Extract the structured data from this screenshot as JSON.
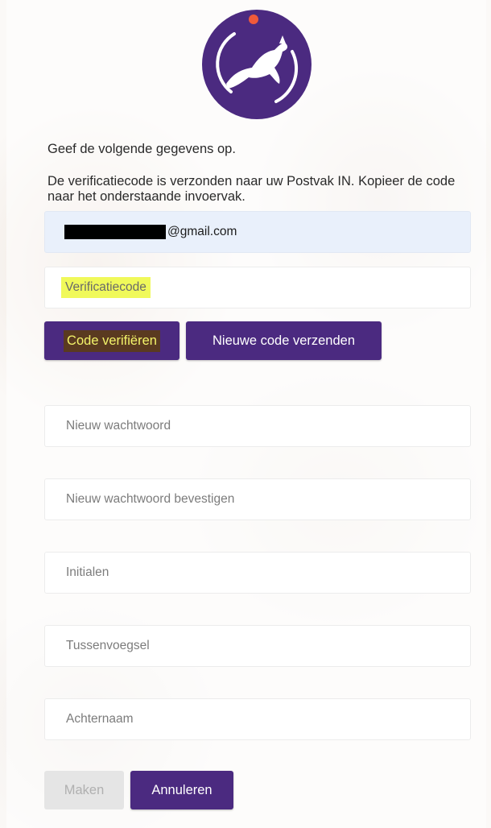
{
  "intro_text": "Geef de volgende gegevens op.",
  "note_text": "De verificatiecode is verzonden naar uw Postvak IN. Kopieer de code naar het onderstaande invoervak.",
  "email": {
    "suffix": "@gmail.com"
  },
  "verification": {
    "placeholder": "Verificatiecode"
  },
  "buttons": {
    "verify": "Code verifiëren",
    "resend": "Nieuwe code verzenden",
    "create": "Maken",
    "cancel": "Annuleren"
  },
  "fields": {
    "new_password": "Nieuw wachtwoord",
    "confirm_password": "Nieuw wachtwoord bevestigen",
    "initials": "Initialen",
    "infix": "Tussenvoegsel",
    "last_name": "Achternaam"
  },
  "colors": {
    "brand_purple": "#4b2a80",
    "accent_orange": "#f05a3a",
    "highlight_yellow": "#f0f95a",
    "email_field_bg": "#e9f0fb"
  },
  "icons": {
    "logo": "dog-jumping-logo-icon"
  }
}
